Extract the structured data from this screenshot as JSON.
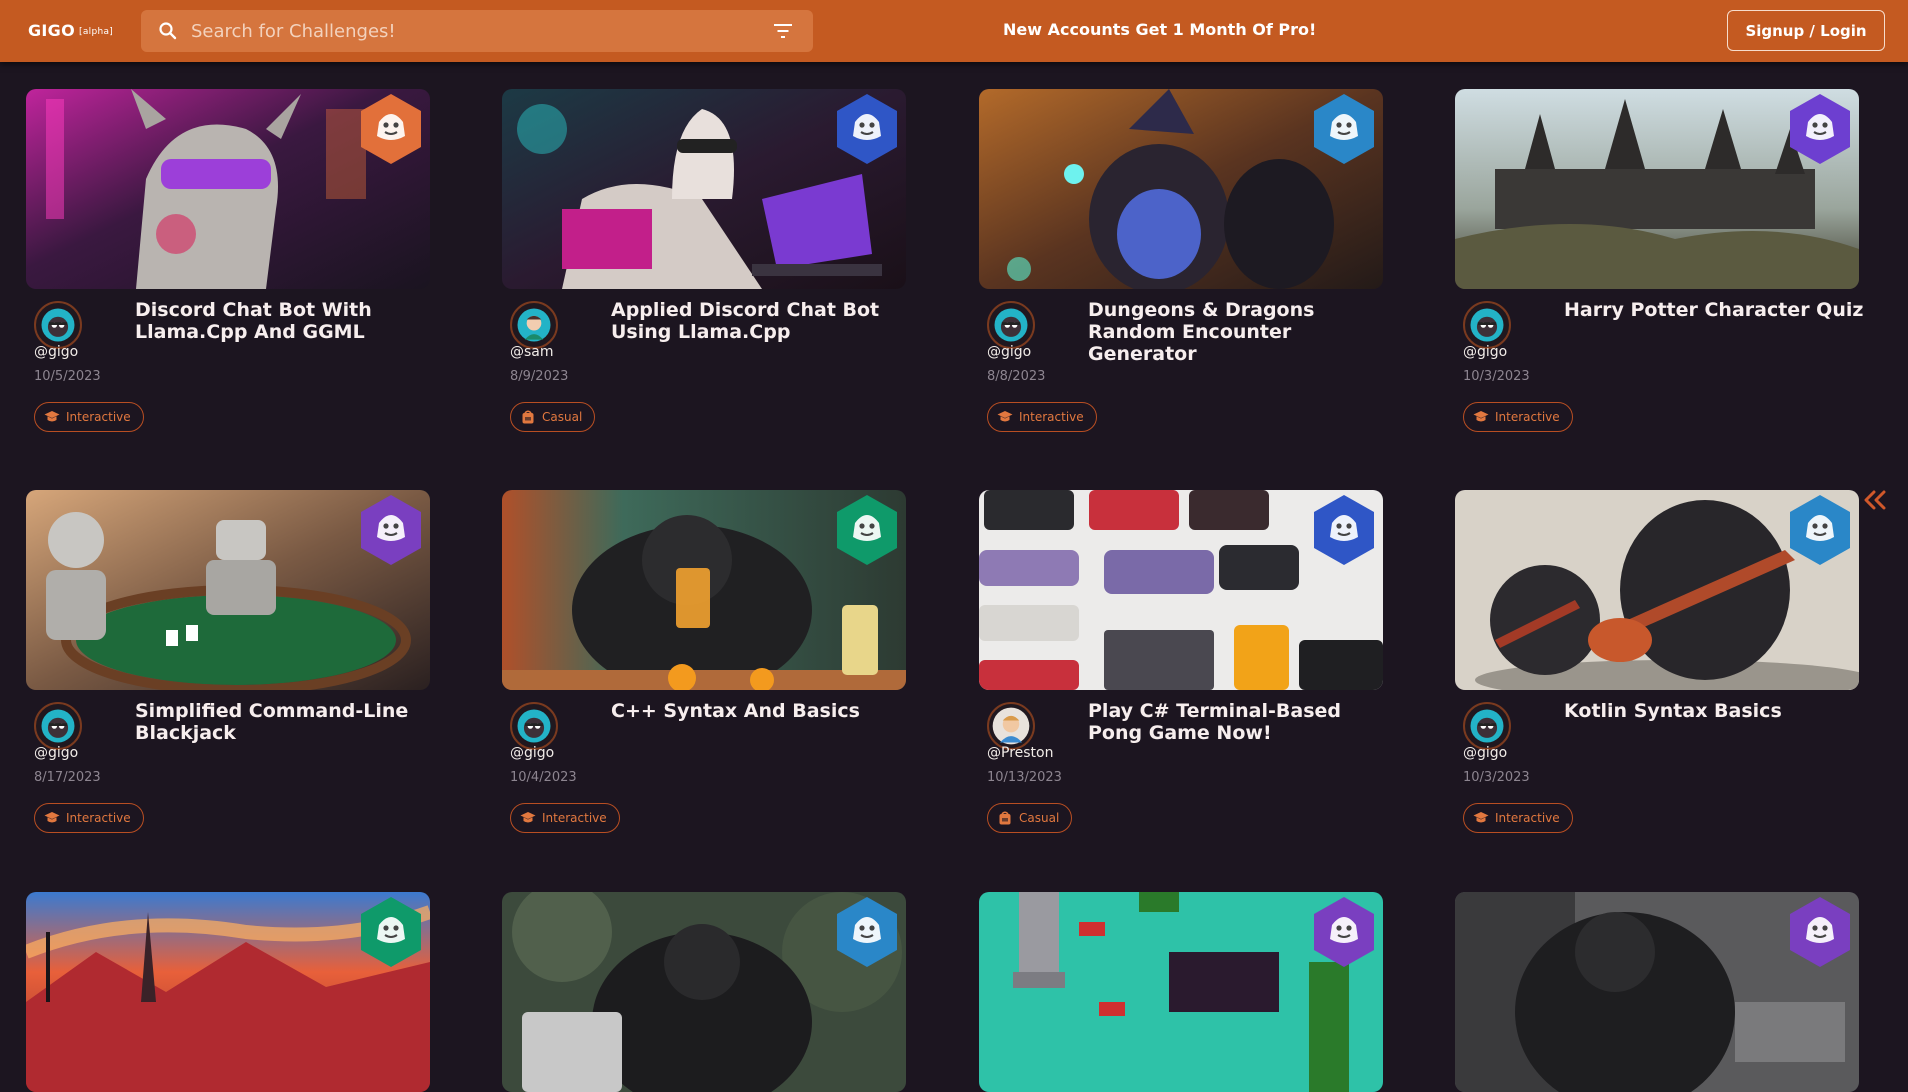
{
  "app": {
    "logo": "GIGO",
    "logo_tag": "[alpha]",
    "search_placeholder": "Search for Challenges!",
    "promo": "New Accounts Get 1 Month Of Pro!",
    "login_label": "Signup / Login"
  },
  "colors": {
    "accent": "#c45a21",
    "background": "#1c1520",
    "tag_border": "#b84e22",
    "tier_orange": "#e2703a",
    "tier_blue": "#2f56c6",
    "tier_purple": "#7a3fc0",
    "tier_green": "#0f9a6a"
  },
  "cards": [
    {
      "title": "Discord Chat Bot With Llama.Cpp And GGML",
      "author": "@gigo",
      "date": "10/5/2023",
      "tag": "Interactive",
      "tag_icon": "graduation-cap-icon",
      "badge": "orange-tier-badge"
    },
    {
      "title": "Applied Discord Chat Bot Using Llama.Cpp",
      "author": "@sam",
      "date": "8/9/2023",
      "tag": "Casual",
      "tag_icon": "backpack-icon",
      "badge": "blue-tier-badge"
    },
    {
      "title": "Dungeons & Dragons Random Encounter Generator",
      "author": "@gigo",
      "date": "8/8/2023",
      "tag": "Interactive",
      "tag_icon": "graduation-cap-icon",
      "badge": "blue-tier-badge"
    },
    {
      "title": "Harry Potter Character Quiz",
      "author": "@gigo",
      "date": "10/3/2023",
      "tag": "Interactive",
      "tag_icon": "graduation-cap-icon",
      "badge": "purple-tier-badge"
    },
    {
      "title": "Simplified Command-Line Blackjack",
      "author": "@gigo",
      "date": "8/17/2023",
      "tag": "Interactive",
      "tag_icon": "graduation-cap-icon",
      "badge": "purple-tier-badge"
    },
    {
      "title": "C++ Syntax And Basics",
      "author": "@gigo",
      "date": "10/4/2023",
      "tag": "Interactive",
      "tag_icon": "graduation-cap-icon",
      "badge": "green-tier-badge"
    },
    {
      "title": "Play C# Terminal-Based Pong Game Now!",
      "author": "@Preston",
      "date": "10/13/2023",
      "tag": "Casual",
      "tag_icon": "backpack-icon",
      "badge": "blue-tier-badge"
    },
    {
      "title": "Kotlin Syntax Basics",
      "author": "@gigo",
      "date": "10/3/2023",
      "tag": "Interactive",
      "tag_icon": "graduation-cap-icon",
      "badge": "blue-tier-badge"
    },
    {
      "title": "",
      "author": "",
      "date": "",
      "tag": "",
      "tag_icon": "",
      "badge": "green-tier-badge"
    },
    {
      "title": "",
      "author": "",
      "date": "",
      "tag": "",
      "tag_icon": "",
      "badge": "blue-tier-badge"
    },
    {
      "title": "",
      "author": "",
      "date": "",
      "tag": "",
      "tag_icon": "",
      "badge": "purple-tier-badge"
    },
    {
      "title": "",
      "author": "",
      "date": "",
      "tag": "",
      "tag_icon": "",
      "badge": "purple-tier-badge"
    }
  ]
}
